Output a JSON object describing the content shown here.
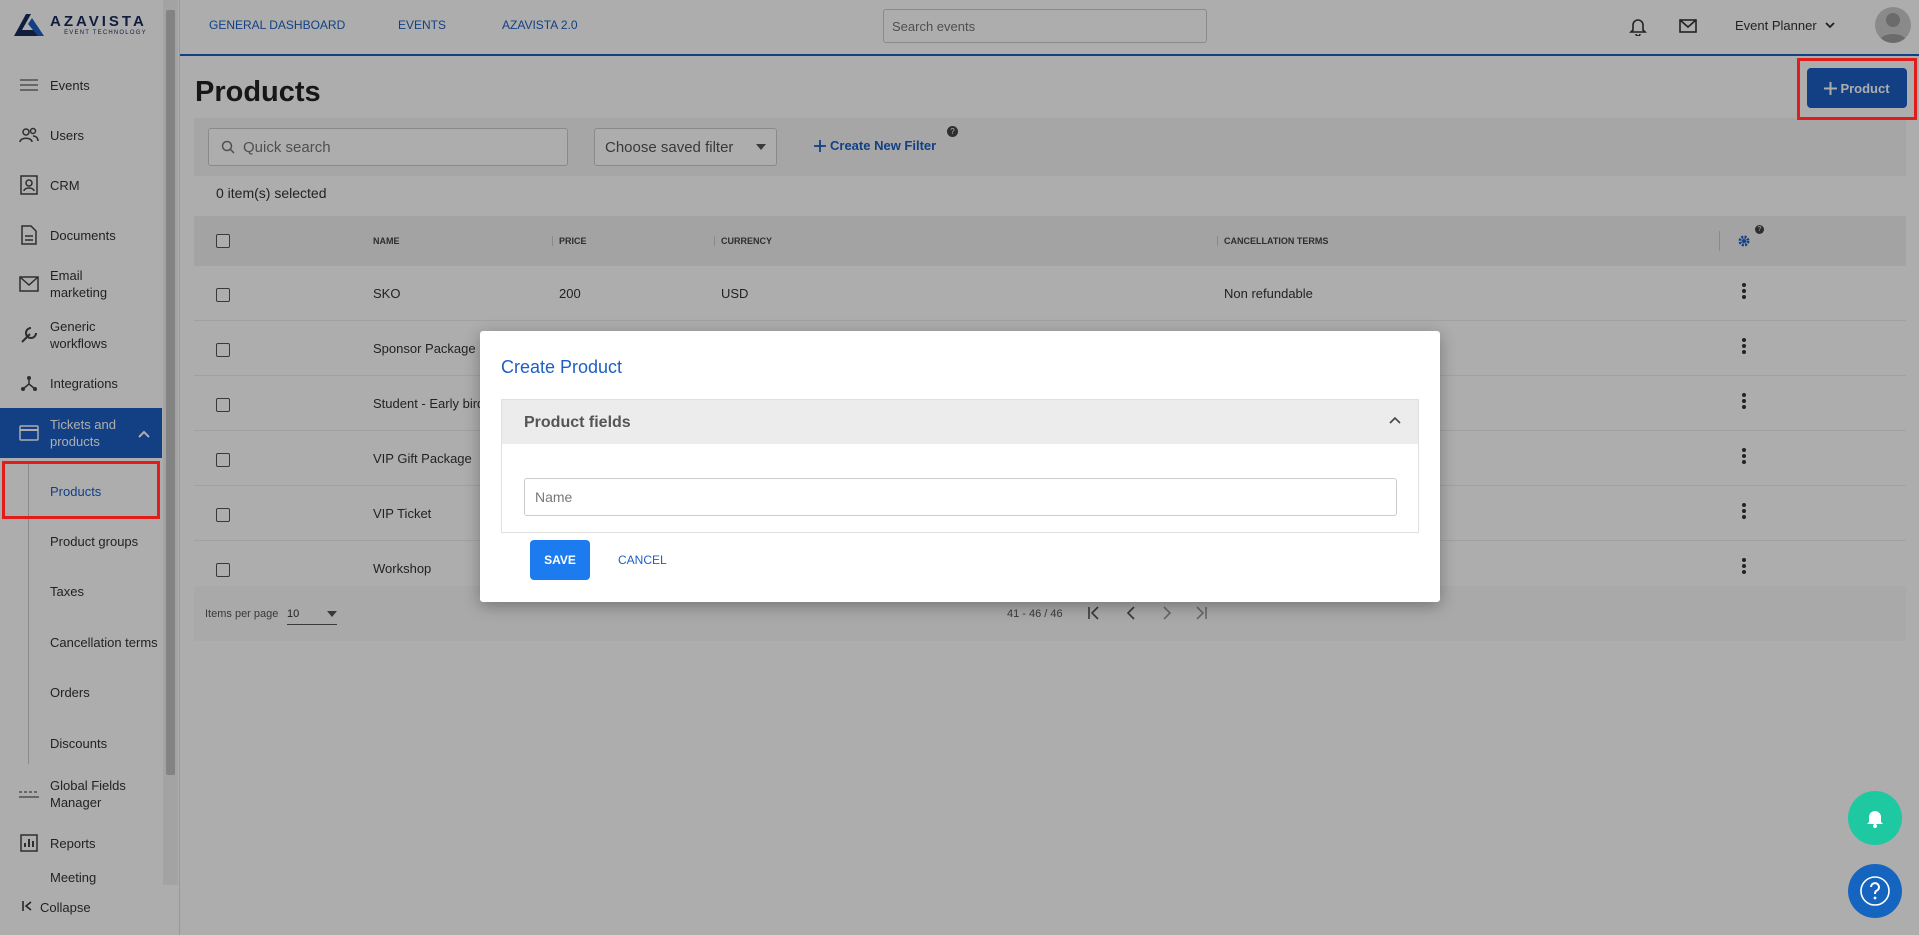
{
  "brand": {
    "name": "AZAVISTA",
    "tagline": "EVENT TECHNOLOGY",
    "logo_icon": "azavista-logo-icon"
  },
  "colors": {
    "accent": "#1d5fc4",
    "highlight": "#e21b1b",
    "notification_fab": "#1ec8a0",
    "help_fab": "#1565c0"
  },
  "sidebar": {
    "items": [
      {
        "label": "Events",
        "icon": "list-icon"
      },
      {
        "label": "Users",
        "icon": "users-icon"
      },
      {
        "label": "CRM",
        "icon": "contacts-icon"
      },
      {
        "label": "Documents",
        "icon": "document-icon"
      },
      {
        "label": "Email marketing",
        "icon": "mail-icon"
      },
      {
        "label": "Generic workflows",
        "icon": "wrench-icon"
      },
      {
        "label": "Integrations",
        "icon": "integration-icon"
      },
      {
        "label": "Tickets and products",
        "icon": "ticket-icon"
      },
      {
        "label": "Global Fields Manager",
        "icon": "fields-icon"
      },
      {
        "label": "Reports",
        "icon": "chart-icon"
      },
      {
        "label": "Meeting"
      }
    ],
    "sub_items": [
      "Products",
      "Product groups",
      "Taxes",
      "Cancellation terms",
      "Orders",
      "Discounts"
    ],
    "collapse_label": "Collapse"
  },
  "topbar": {
    "links": [
      "GENERAL DASHBOARD",
      "EVENTS",
      "AZAVISTA 2.0"
    ],
    "search_placeholder": "Search events",
    "user_role": "Event Planner"
  },
  "main": {
    "title": "Products",
    "add_button": "Product",
    "quick_search_placeholder": "Quick search",
    "saved_filter_label": "Choose saved filter",
    "create_filter_label": "Create New Filter",
    "selected_count": "0 item(s) selected"
  },
  "table": {
    "columns": [
      "NAME",
      "PRICE",
      "CURRENCY",
      "CANCELLATION TERMS"
    ],
    "rows": [
      {
        "name": "SKO",
        "price": "200",
        "currency": "USD",
        "terms": "Non refundable"
      },
      {
        "name": "Sponsor Package",
        "price": "",
        "currency": "",
        "terms": ""
      },
      {
        "name": "Student - Early bird",
        "price": "",
        "currency": "",
        "terms": ""
      },
      {
        "name": "VIP Gift Package",
        "price": "",
        "currency": "",
        "terms": ""
      },
      {
        "name": "VIP Ticket",
        "price": "",
        "currency": "",
        "terms": ""
      },
      {
        "name": "Workshop",
        "price": "",
        "currency": "",
        "terms": ""
      }
    ]
  },
  "pager": {
    "items_per_page_label": "Items per page",
    "items_per_page": "10",
    "range": "41 - 46 / 46"
  },
  "modal": {
    "title": "Create Product",
    "panel_title": "Product fields",
    "name_placeholder": "Name",
    "save_label": "SAVE",
    "cancel_label": "CANCEL"
  },
  "help_marker": "?"
}
